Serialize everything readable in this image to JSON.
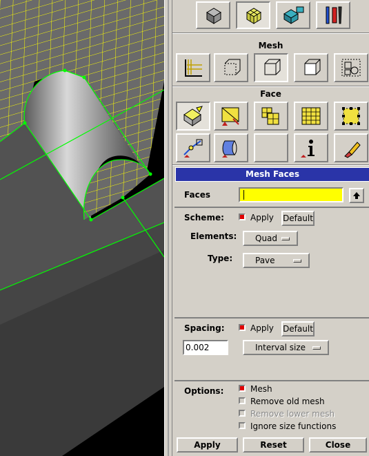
{
  "toolbar_top": {
    "buttons": [
      {
        "icon": "geometry-icon"
      },
      {
        "icon": "mesh-icon"
      },
      {
        "icon": "boundary-zones-icon"
      },
      {
        "icon": "tools-icon"
      }
    ]
  },
  "mesh_section": {
    "title": "Mesh",
    "buttons": [
      {
        "icon": "edge-mesh-icon"
      },
      {
        "icon": "face-mesh-icon"
      },
      {
        "icon": "volume-mesh-icon"
      },
      {
        "icon": "block-mesh-icon"
      },
      {
        "icon": "group-mesh-icon"
      }
    ]
  },
  "face_section": {
    "title": "Face",
    "buttons_row1": [
      {
        "icon": "mesh-faces-icon"
      },
      {
        "icon": "link-faces-icon"
      },
      {
        "icon": "modify-face-mesh-icon"
      },
      {
        "icon": "smooth-face-mesh-icon"
      },
      {
        "icon": "set-element-type-icon"
      }
    ],
    "buttons_row2": [
      {
        "icon": "move-face-nodes-icon"
      },
      {
        "icon": "face-mesh-display-icon"
      },
      {
        "icon": "blank-icon"
      },
      {
        "icon": "info-icon"
      },
      {
        "icon": "delete-face-mesh-icon"
      }
    ]
  },
  "form": {
    "title": "Mesh Faces",
    "faces_label": "Faces",
    "faces_value": "",
    "scheme": {
      "label": "Scheme:",
      "apply_label": "Apply",
      "apply_checked": true,
      "default_label": "Default",
      "elements_label": "Elements:",
      "elements_value": "Quad",
      "type_label": "Type:",
      "type_value": "Pave"
    },
    "spacing": {
      "label": "Spacing:",
      "apply_label": "Apply",
      "apply_checked": true,
      "default_label": "Default",
      "value": "0.002",
      "method_value": "Interval size"
    },
    "options": {
      "label": "Options:",
      "items": [
        {
          "label": "Mesh",
          "checked": true,
          "enabled": true
        },
        {
          "label": "Remove old mesh",
          "checked": false,
          "enabled": true
        },
        {
          "label": "Remove lower mesh",
          "checked": false,
          "enabled": false
        },
        {
          "label": "Ignore size functions",
          "checked": false,
          "enabled": true
        }
      ]
    },
    "actions": {
      "apply": "Apply",
      "reset": "Reset",
      "close": "Close"
    }
  },
  "colors": {
    "mesh_lines": "#ffff00",
    "edges": "#00ff00",
    "panel_bg": "#d4d0c8",
    "title_bar": "#2a34a8",
    "faces_field": "#ffff00",
    "check_on": "#e00000"
  }
}
